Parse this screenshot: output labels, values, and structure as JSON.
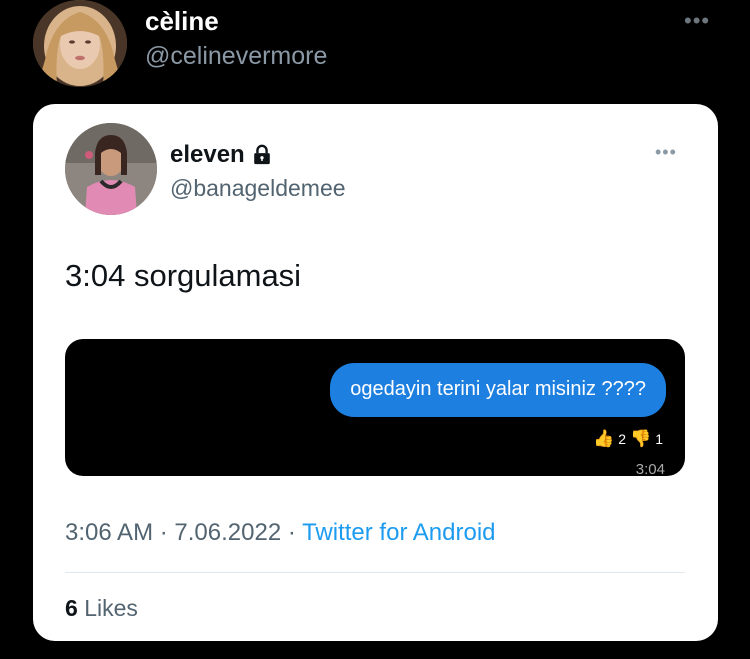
{
  "outer_tweet": {
    "author_name": "cèline",
    "author_handle": "@celinevermore",
    "more_icon": "more-horizontal-icon"
  },
  "quoted_tweet": {
    "author_name": "eleven",
    "author_handle": "@banageldemee",
    "protected_icon": "lock-icon",
    "more_icon": "more-horizontal-icon",
    "text": "3:04 sorgulamasi",
    "media": {
      "message_text": "ogedayin terini yalar misiniz ????",
      "thumbs_up_count": "2",
      "thumbs_down_count": "1",
      "message_time": "3:04"
    },
    "time": "3:06 AM",
    "separator": " · ",
    "date": "7.06.2022",
    "source": "Twitter for Android",
    "likes_count": "6",
    "likes_label": "Likes"
  },
  "colors": {
    "background": "#000000",
    "card": "#ffffff",
    "bubble": "#1d7fe0",
    "link": "#1d9bf0",
    "secondary_text": "#536471"
  }
}
